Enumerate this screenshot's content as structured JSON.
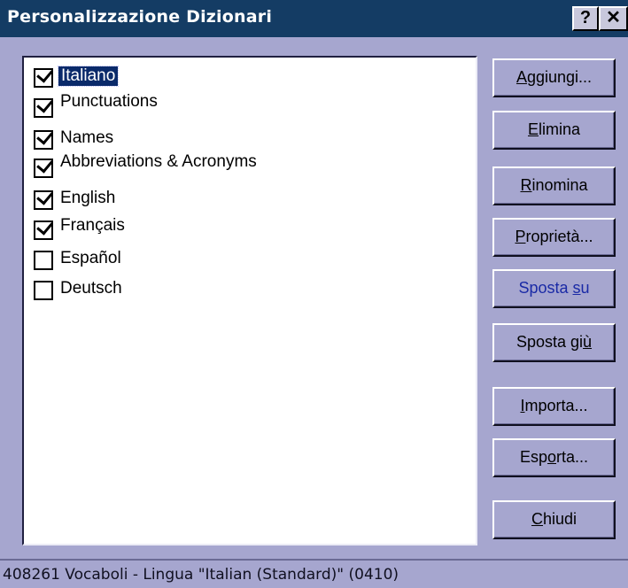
{
  "window": {
    "title": "Personalizzazione Dizionari",
    "help_label": "?",
    "close_label": "✕"
  },
  "dictionaries": [
    {
      "label": "Italiano",
      "checked": true,
      "selected": true
    },
    {
      "label": "Punctuations",
      "checked": true,
      "selected": false
    },
    {
      "label": "Names",
      "checked": true,
      "selected": false
    },
    {
      "label": "Abbreviations & Acronyms",
      "checked": true,
      "selected": false
    },
    {
      "label": "English",
      "checked": true,
      "selected": false
    },
    {
      "label": "Français",
      "checked": true,
      "selected": false
    },
    {
      "label": "Español",
      "checked": false,
      "selected": false
    },
    {
      "label": "Deutsch",
      "checked": false,
      "selected": false
    }
  ],
  "buttons": {
    "add": {
      "pre": "",
      "key": "A",
      "post": "ggiungi..."
    },
    "delete": {
      "pre": "",
      "key": "E",
      "post": "limina"
    },
    "rename": {
      "pre": "",
      "key": "R",
      "post": "inomina"
    },
    "properties": {
      "pre": "",
      "key": "P",
      "post": "roprietà..."
    },
    "move_up": {
      "pre": "Sposta ",
      "key": "s",
      "post": "u"
    },
    "move_down": {
      "pre": "Sposta gi",
      "key": "ù",
      "post": ""
    },
    "import": {
      "pre": "",
      "key": "I",
      "post": "mporta..."
    },
    "export": {
      "pre": "Esp",
      "key": "o",
      "post": "rta..."
    },
    "close": {
      "pre": "",
      "key": "C",
      "post": "hiudi"
    }
  },
  "status": {
    "text": "408261 Vocaboli - Lingua \"Italian (Standard)\" (0410)"
  }
}
